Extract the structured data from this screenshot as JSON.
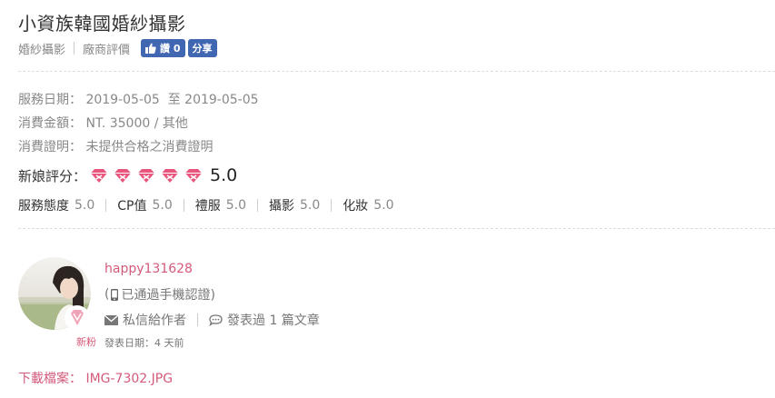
{
  "vendor": {
    "title": "小資族韓國婚紗攝影",
    "category": "婚紗攝影",
    "reviews_link": "廠商評價"
  },
  "facebook": {
    "like_label": "讚 0",
    "share_label": "分享"
  },
  "review": {
    "service_date_label": "服務日期：",
    "service_date_value": "2019-05-05  至 2019-05-05",
    "amount_label": "消費金額：",
    "amount_value": "NT. 35000 / 其他",
    "proof_label": "消費證明：",
    "proof_value": "未提供合格之消費證明",
    "bride_rating_label": "新娘評分：",
    "bride_rating_gems": 5,
    "bride_rating_score": "5.0",
    "sub_ratings": [
      {
        "label": "服務態度",
        "score": "5.0"
      },
      {
        "label": "CP值",
        "score": "5.0"
      },
      {
        "label": "禮服",
        "score": "5.0"
      },
      {
        "label": "攝影",
        "score": "5.0"
      },
      {
        "label": "化妝",
        "score": "5.0"
      }
    ]
  },
  "author": {
    "username": "happy131628",
    "verified_text": "已通過手機認證)",
    "verified_prefix": "(",
    "badge_label": "新粉",
    "post_date": "發表日期：4 天前",
    "message_label": "私信給作者",
    "posts_label": "發表過 1 篇文章"
  },
  "download": {
    "label": "下載檔案：",
    "filename": "IMG-7302.JPG"
  },
  "colors": {
    "accent_pink": "#d35a7a",
    "gem_pink": "#e8567e",
    "facebook_blue": "#4267b2",
    "muted_text": "#888888"
  }
}
